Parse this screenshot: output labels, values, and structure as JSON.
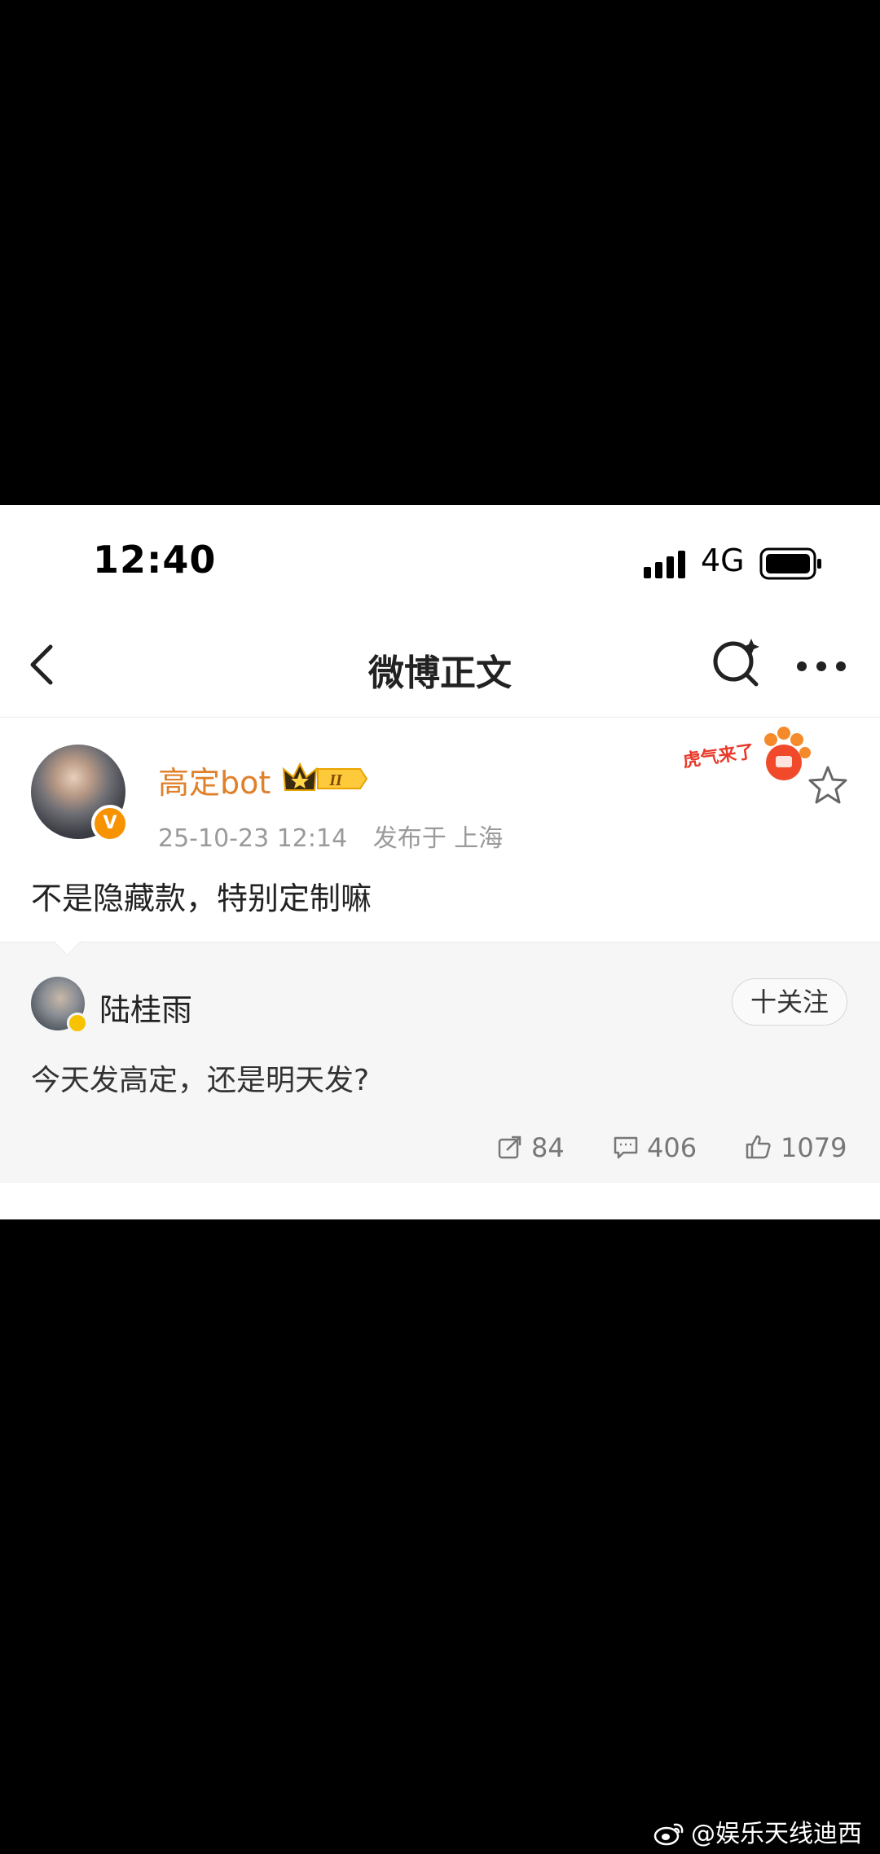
{
  "status_bar": {
    "time": "12:40",
    "network": "4G"
  },
  "nav": {
    "title": "微博正文"
  },
  "post": {
    "author": "高定bot",
    "vip_level": "II",
    "timestamp": "25-10-23 12:14",
    "location": "发布于 上海",
    "text": "不是隐藏款，特别定制嘛",
    "sticker": "虎气来了"
  },
  "quoted": {
    "author": "陆桂雨",
    "follow_label": "十关注",
    "text": "今天发高定，还是明天发?",
    "reposts": "84",
    "comments": "406",
    "likes": "1079"
  },
  "next_item_peek": "",
  "watermark": "@娱乐天线迪西"
}
